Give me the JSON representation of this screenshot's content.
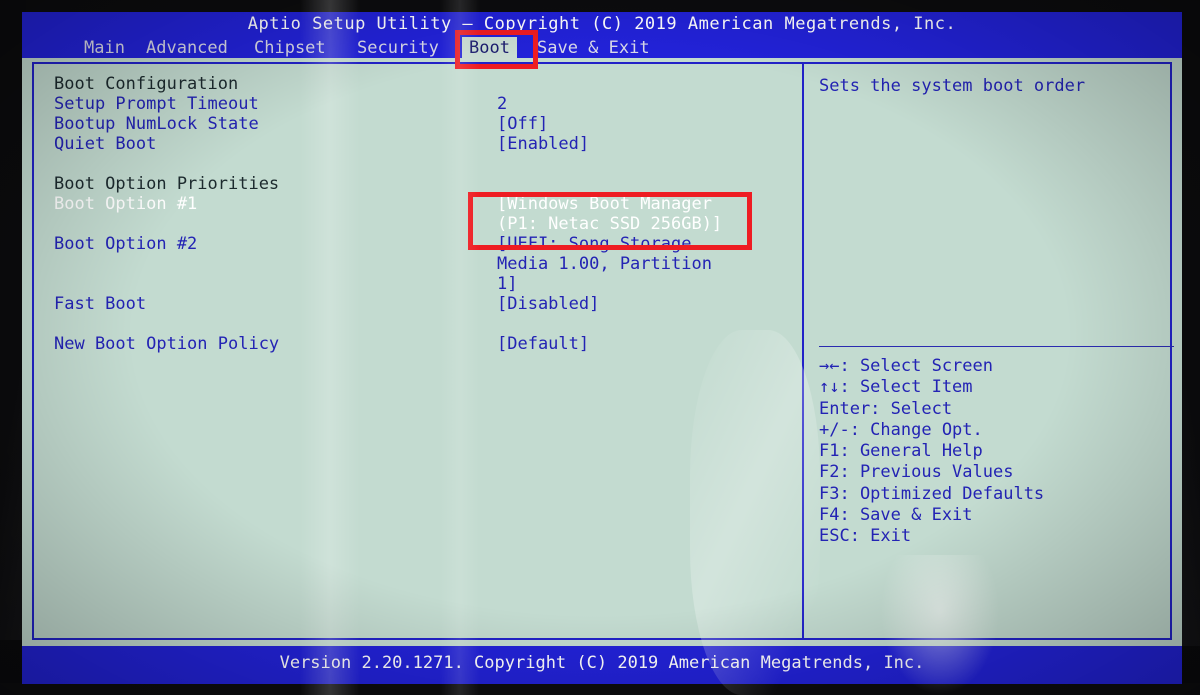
{
  "window": {
    "title": "Aptio Setup Utility – Copyright (C) 2019 American Megatrends, Inc.",
    "version_bar": "Version 2.20.1271. Copyright (C) 2019 American Megatrends, Inc."
  },
  "menubar": {
    "items": [
      {
        "label": "Main",
        "active": false
      },
      {
        "label": "Advanced",
        "active": false
      },
      {
        "label": "Chipset",
        "active": false
      },
      {
        "label": "Security",
        "active": false
      },
      {
        "label": "Boot",
        "active": true
      },
      {
        "label": "Save & Exit",
        "active": false
      }
    ]
  },
  "settings": {
    "section_boot_configuration": "Boot Configuration",
    "rows": [
      {
        "label": "Setup Prompt Timeout",
        "value": "2"
      },
      {
        "label": "Bootup NumLock State",
        "value": "[Off]"
      },
      {
        "label": "Quiet Boot",
        "value": "[Enabled]"
      }
    ],
    "section_boot_option_priorities": "Boot Option Priorities",
    "boot_option_1": {
      "label": "Boot Option #1",
      "value_line_1": "[Windows Boot Manager",
      "value_line_2": "(P1: Netac SSD 256GB)]"
    },
    "boot_option_2": {
      "label": "Boot Option #2",
      "value_line_1": "[UEFI: Song Storage",
      "value_line_2": "Media 1.00, Partition",
      "value_line_3": "1]"
    },
    "fast_boot": {
      "label": "Fast Boot",
      "value": "[Disabled]"
    },
    "new_boot_option_policy": {
      "label": "New Boot Option Policy",
      "value": "[Default]"
    }
  },
  "help_panel": {
    "description": "Sets the system boot order",
    "keys": [
      "→←: Select Screen",
      "↑↓: Select Item",
      "Enter: Select",
      "+/-: Change Opt.",
      "F1: General Help",
      "F2: Previous Values",
      "F3: Optimized Defaults",
      "F4: Save & Exit",
      "ESC: Exit"
    ]
  },
  "annotations": {
    "box_color": "#ee1c22",
    "box_tab_target": "Boot",
    "box_value_target": "[Windows Boot Manager (P1: Netac SSD 256GB)]"
  },
  "colors": {
    "screen_background": "#c3dbd0",
    "chrome_blue": "#2222d8",
    "text_blue": "#2323b4",
    "selected_text": "#ffffff",
    "heading_text": "#1c2a2e"
  }
}
